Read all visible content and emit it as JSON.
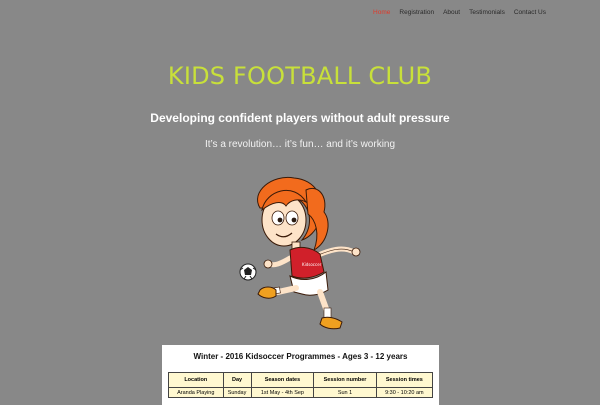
{
  "nav": {
    "items": [
      {
        "label": "Home",
        "active": true
      },
      {
        "label": "Registration",
        "active": false
      },
      {
        "label": "About",
        "active": false
      },
      {
        "label": "Testimonials",
        "active": false
      },
      {
        "label": "Contact Us",
        "active": false
      }
    ]
  },
  "hero": {
    "title": "KIDS FOOTBALL CLUB",
    "subtitle": "Developing confident players without adult pressure",
    "tagline": "It’s a revolution… it’s fun… and it’s working"
  },
  "mascot": {
    "icon": "girl-kicking-soccer-ball-illustration"
  },
  "programme": {
    "title": "Winter - 2016 Kidsoccer Programmes - Ages 3 - 12 years",
    "headers": [
      "Location",
      "Day",
      "Season dates",
      "Session number",
      "Session times"
    ],
    "rows": [
      [
        "Aranda Playing",
        "Sunday",
        "1st May - 4th Sep",
        "Sun 1",
        "9:30 - 10:20 am"
      ]
    ]
  },
  "colors": {
    "background": "#888888",
    "title": "#c8e03a",
    "nav_active": "#e03a2a",
    "table_fill": "#fff8d0"
  }
}
